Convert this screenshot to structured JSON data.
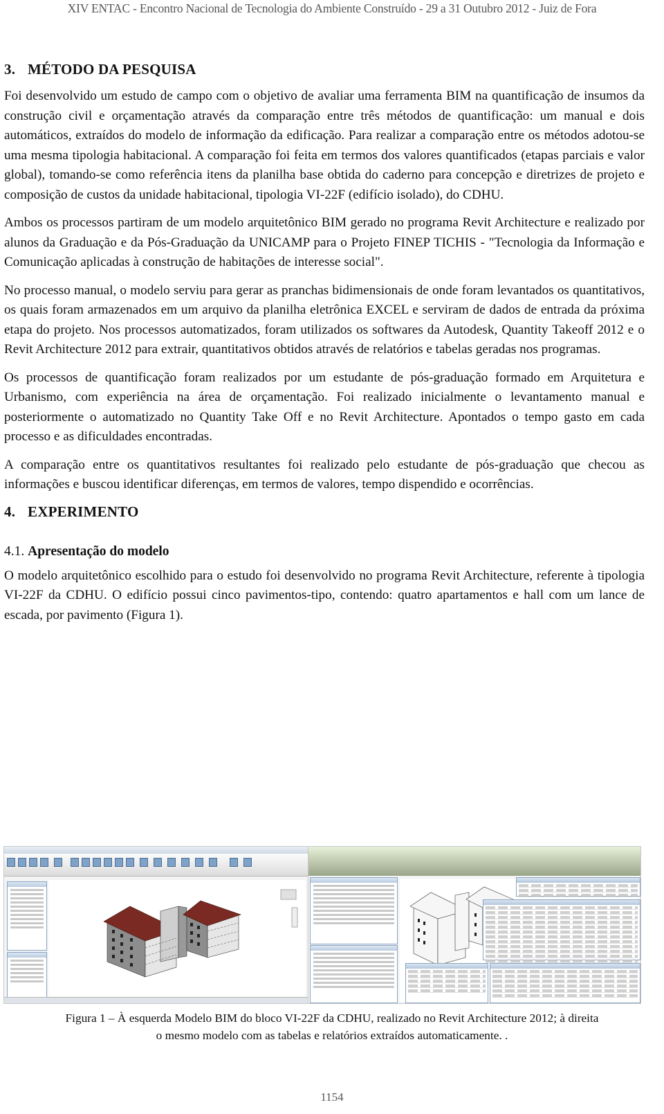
{
  "running_header": "XIV ENTAC - Encontro Nacional de Tecnologia do Ambiente Construído - 29 a 31 Outubro 2012 - Juiz de Fora",
  "section3": {
    "number": "3.",
    "title": "MÉTODO DA PESQUISA",
    "paragraphs": [
      "Foi desenvolvido um estudo de campo com o objetivo de avaliar uma ferramenta BIM na quantificação de insumos da construção civil e orçamentação através da comparação entre três métodos de quantificação: um manual e dois automáticos, extraídos do modelo de informação da edificação. Para realizar a comparação entre os métodos adotou-se uma mesma tipologia habitacional. A comparação foi feita em termos dos valores quantificados (etapas parciais e valor global), tomando-se como referência itens da planilha base obtida do caderno para concepção e diretrizes de projeto e composição de custos da unidade habitacional, tipologia VI-22F (edifício isolado), do CDHU.",
      "Ambos os processos partiram de um modelo arquitetônico BIM gerado no programa Revit Architecture e realizado por alunos da  Graduação e da Pós-Graduação da UNICAMP para o Projeto FINEP TICHIS - \"Tecnologia da Informação e Comunicação aplicadas à construção de habitações de interesse social\".",
      "No processo manual, o modelo serviu para gerar as pranchas bidimensionais de onde foram levantados os quantitativos, os quais foram armazenados em um arquivo da planilha eletrônica EXCEL e serviram de dados de entrada da próxima etapa do projeto. Nos processos automatizados, foram utilizados os softwares da Autodesk, Quantity Takeoff 2012 e o Revit Architecture 2012 para extrair, quantitativos obtidos através de relatórios e tabelas geradas nos programas.",
      "Os processos de quantificação foram realizados por um estudante de pós-graduação formado em Arquitetura e Urbanismo, com experiência na área de orçamentação. Foi realizado inicialmente o levantamento manual e posteriormente o automatizado no Quantity Take Off e no Revit Architecture. Apontados o tempo gasto em cada processo e as dificuldades encontradas.",
      "A comparação entre os quantitativos resultantes foi realizado pelo estudante de pós-graduação que checou as informações e buscou identificar diferenças, em termos de valores, tempo dispendido e ocorrências."
    ]
  },
  "section4": {
    "number": "4.",
    "title": "EXPERIMENTO",
    "subsection": {
      "number": "4.1.",
      "title": "Apresentação do modelo",
      "paragraphs": [
        "O modelo arquitetônico escolhido para o estudo foi desenvolvido no programa Revit Architecture, referente à tipologia VI-22F da CDHU. O edifício possui cinco pavimentos-tipo, contendo: quatro apartamentos e hall com um lance de escada, por pavimento (Figura 1)."
      ]
    }
  },
  "figure": {
    "left_image": "revit-3d-model-screenshot",
    "right_image": "revit-model-with-schedules-screenshot",
    "caption_line1": "Figura 1 –  À esquerda Modelo BIM do bloco VI-22F da CDHU, realizado no Revit Architecture 2012; à direita",
    "caption_line2": "o mesmo modelo com as tabelas e relatórios extraídos automaticamente. ."
  },
  "page_number": "1154",
  "colors": {
    "roof": "#7a2a22",
    "ribbon_green": "#9aa58a",
    "panel_blue": "#8aa5c3"
  }
}
